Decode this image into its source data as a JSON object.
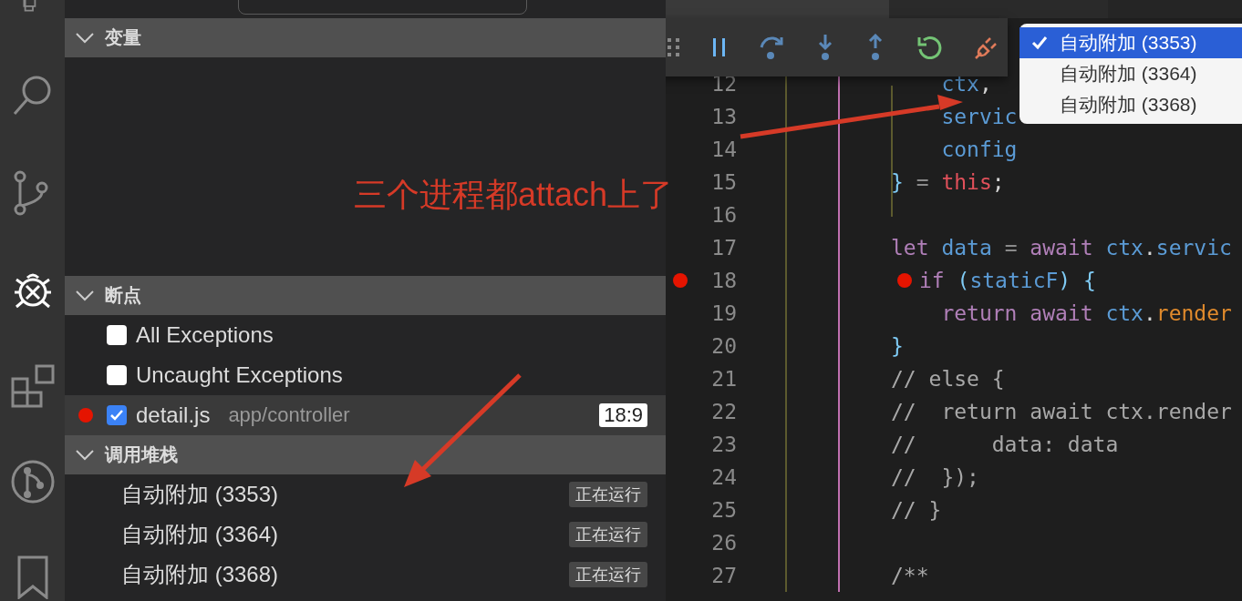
{
  "sidebar": {
    "variables": {
      "title": "变量",
      "expanded": true
    },
    "breakpoints": {
      "title": "断点",
      "expanded": true,
      "items": [
        {
          "kind": "exception",
          "label": "All Exceptions",
          "checked": false,
          "selected": false
        },
        {
          "kind": "exception",
          "label": "Uncaught Exceptions",
          "checked": false,
          "selected": false
        },
        {
          "kind": "file",
          "label": "detail.js",
          "path": "app/controller",
          "location": "18:9",
          "checked": true,
          "selected": true
        }
      ]
    },
    "call_stack": {
      "title": "调用堆栈",
      "expanded": true,
      "items": [
        {
          "label": "自动附加 (3353)",
          "status": "正在运行"
        },
        {
          "label": "自动附加 (3364)",
          "status": "正在运行"
        },
        {
          "label": "自动附加 (3368)",
          "status": "正在运行"
        }
      ]
    }
  },
  "process_menu": {
    "items": [
      {
        "label": "自动附加 (3353)",
        "selected": true
      },
      {
        "label": "自动附加 (3364)",
        "selected": false
      },
      {
        "label": "自动附加 (3368)",
        "selected": false
      }
    ]
  },
  "editor": {
    "lines": [
      {
        "number": "12",
        "breakpoint": false,
        "tokens": [
          {
            "text": "    ctx",
            "kind": "var"
          },
          {
            "text": ",",
            "kind": "punct"
          }
        ]
      },
      {
        "number": "13",
        "breakpoint": false,
        "tokens": [
          {
            "text": "    servic",
            "kind": "var"
          }
        ]
      },
      {
        "number": "14",
        "breakpoint": false,
        "tokens": [
          {
            "text": "    config",
            "kind": "var"
          }
        ]
      },
      {
        "number": "15",
        "breakpoint": false,
        "tokens": [
          {
            "text": "}",
            "kind": "bracket"
          },
          {
            "text": " = ",
            "kind": "op"
          },
          {
            "text": "this",
            "kind": "this"
          },
          {
            "text": ";",
            "kind": "punct"
          }
        ]
      },
      {
        "number": "16",
        "breakpoint": false
      },
      {
        "number": "17",
        "breakpoint": false,
        "tokens": [
          {
            "text": "let ",
            "kind": "keyword"
          },
          {
            "text": "data",
            "kind": "var"
          },
          {
            "text": " = ",
            "kind": "op"
          },
          {
            "text": "await ",
            "kind": "keyword"
          },
          {
            "text": "ctx",
            "kind": "var"
          },
          {
            "text": ".",
            "kind": "punct"
          },
          {
            "text": "servic",
            "kind": "var"
          }
        ]
      },
      {
        "number": "18",
        "breakpoint": true,
        "inline_breakpoint": true,
        "tokens": [
          {
            "text": "if ",
            "kind": "keyword"
          },
          {
            "text": "(",
            "kind": "bracket"
          },
          {
            "text": "staticF",
            "kind": "var"
          },
          {
            "text": ") {",
            "kind": "bracket"
          }
        ]
      },
      {
        "number": "19",
        "breakpoint": false,
        "tokens": [
          {
            "text": "    return await ",
            "kind": "keyword"
          },
          {
            "text": "ctx",
            "kind": "var"
          },
          {
            "text": ".",
            "kind": "punct"
          },
          {
            "text": "render",
            "kind": "method"
          }
        ]
      },
      {
        "number": "20",
        "breakpoint": false,
        "tokens": [
          {
            "text": "}",
            "kind": "bracket"
          }
        ]
      },
      {
        "number": "21",
        "breakpoint": false,
        "tokens": [
          {
            "text": "// else {",
            "kind": "comment"
          }
        ]
      },
      {
        "number": "22",
        "breakpoint": false,
        "tokens": [
          {
            "text": "//  return await ctx.render",
            "kind": "comment"
          }
        ]
      },
      {
        "number": "23",
        "breakpoint": false,
        "tokens": [
          {
            "text": "//      data: data",
            "kind": "comment"
          }
        ]
      },
      {
        "number": "24",
        "breakpoint": false,
        "tokens": [
          {
            "text": "//  });",
            "kind": "comment"
          }
        ]
      },
      {
        "number": "25",
        "breakpoint": false,
        "tokens": [
          {
            "text": "// }",
            "kind": "comment"
          }
        ]
      },
      {
        "number": "26",
        "breakpoint": false
      },
      {
        "number": "27",
        "breakpoint": false,
        "tokens": [
          {
            "text": "/**",
            "kind": "comment"
          }
        ]
      }
    ]
  },
  "annotation": {
    "text": "三个进程都attach上了"
  }
}
